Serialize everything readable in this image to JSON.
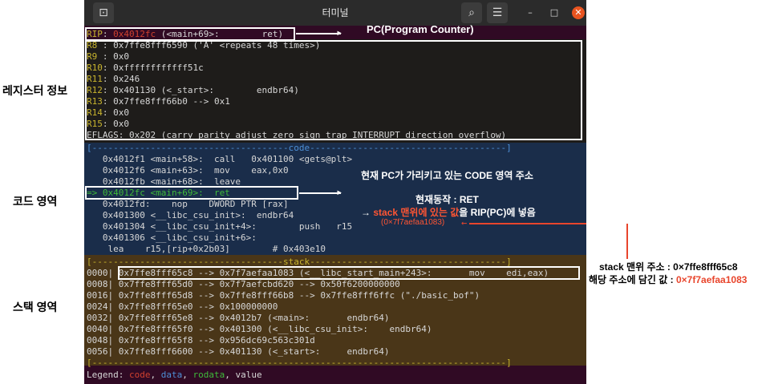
{
  "window": {
    "title": "터미널",
    "new_tab_icon": "terminal-icon",
    "search_icon": "search-icon",
    "menu_icon": "menu-icon",
    "minimize": "–",
    "maximize": "□",
    "close": "✕"
  },
  "registers": {
    "rip": {
      "label": "RIP",
      "addr": "0x4012fc",
      "sym": "(<main+69>:",
      "instr": "ret)"
    },
    "lines": [
      {
        "name": "R8 ",
        "value": "0x7ffe8fff6590 ('A' <repeats 48 times>)"
      },
      {
        "name": "R9 ",
        "value": "0x0"
      },
      {
        "name": "R10",
        "value": "0xffffffffffff51c"
      },
      {
        "name": "R11",
        "value": "0x246"
      },
      {
        "name": "R12",
        "value": "0x401130 (<_start>:        endbr64)"
      },
      {
        "name": "R13",
        "value": "0x7ffe8fff66b0 --> 0x1"
      },
      {
        "name": "R14",
        "value": "0x0"
      },
      {
        "name": "R15",
        "value": "0x0"
      }
    ],
    "eflags": "EFLAGS: 0x202 (carry parity adjust zero sign trap INTERRUPT direction overflow)"
  },
  "code": {
    "header": "[-------------------------------------code-------------------------------------]",
    "lines": [
      "   0x4012f1 <main+58>:  call   0x401100 <gets@plt>",
      "   0x4012f6 <main+63>:  mov    eax,0x0",
      "   0x4012fb <main+68>:  leave",
      "=> 0x4012fc <main+69>:  ret",
      "   0x4012fd:    nop    DWORD PTR [rax]",
      "   0x401300 <__libc_csu_init>:  endbr64",
      "   0x401304 <__libc_csu_init+4>:        push   r15",
      "   0x401306 <__libc_csu_init+6>:",
      "    lea    r15,[rip+0x2b03]        # 0x403e10"
    ]
  },
  "stack": {
    "header": "[------------------------------------stack-------------------------------------]",
    "lines": [
      "0000| 0x7ffe8fff65c8 --> 0x7f7aefaa1083 (<__libc_start_main+243>:       mov    edi,eax)",
      "0008| 0x7ffe8fff65d0 --> 0x7f7aefcbd620 --> 0x50f6200000000",
      "0016| 0x7ffe8fff65d8 --> 0x7ffe8fff66b8 --> 0x7ffe8fff6ffc (\"./basic_bof\")",
      "0024| 0x7ffe8fff65e0 --> 0x100000000",
      "0032| 0x7ffe8fff65e8 --> 0x4012b7 (<main>:       endbr64)",
      "0040| 0x7ffe8fff65f0 --> 0x401300 (<__libc_csu_init>:    endbr64)",
      "0048| 0x7ffe8fff65f8 --> 0x956dc69c563c301d",
      "0056| 0x7ffe8fff6600 --> 0x401130 (<_start>:     endbr64)"
    ],
    "footer": "[------------------------------------------------------------------------------]"
  },
  "legend": {
    "label": "Legend:",
    "code": "code",
    "data": "data",
    "rodata": "rodata",
    "value": "value"
  },
  "annotations": {
    "pc": "PC(Program Counter)",
    "current_pc": "현재 PC가 가리키고 있는 CODE 영역 주소",
    "current_op": "현재동작 : RET",
    "action_prefix": "→ ",
    "action_red": "stack 맨위에 있는 값",
    "action_rest": "을 RIP(PC)에 넣음",
    "action_value": "(0×7f7aefaa1083)",
    "stack_top": "stack 맨위 주소 : 0×7ffe8fff65c8",
    "stack_value_label": "해당 주소에 담긴 값 : ",
    "stack_value": "0×7f7aefaa1083"
  },
  "sections": {
    "registers": "레지스터 정보",
    "code": "코드 영역",
    "stack": "스택 영역"
  },
  "colors": {
    "terminal_bg": "#300a24",
    "accent_red": "#e8452c",
    "code_bg": "#1a2d4a",
    "stack_bg": "#4a3618"
  }
}
